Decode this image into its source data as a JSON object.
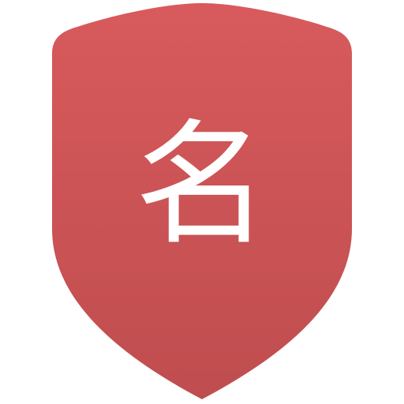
{
  "icon": {
    "name": "shield-icon",
    "glyph": "名",
    "colors": {
      "top": "#d85a5c",
      "bottom": "#bf4d4f",
      "glyph": "#ffffff",
      "background": "#ffffff"
    }
  }
}
